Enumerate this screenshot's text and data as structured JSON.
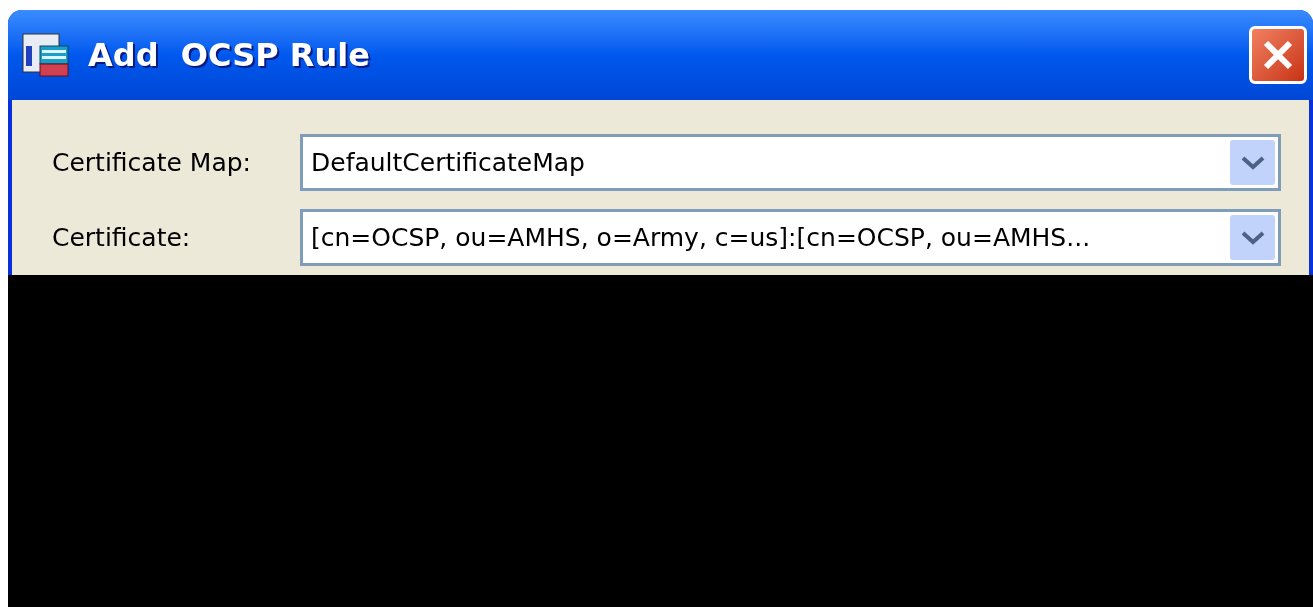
{
  "window": {
    "title": "Add  OCSP Rule"
  },
  "fields": [
    {
      "label": "Certificate Map:",
      "value": "DefaultCertificateMap"
    },
    {
      "label": "Certificate:",
      "value": "[cn=OCSP, ou=AMHS, o=Army, c=us]:[cn=OCSP, ou=AMHS..."
    }
  ]
}
